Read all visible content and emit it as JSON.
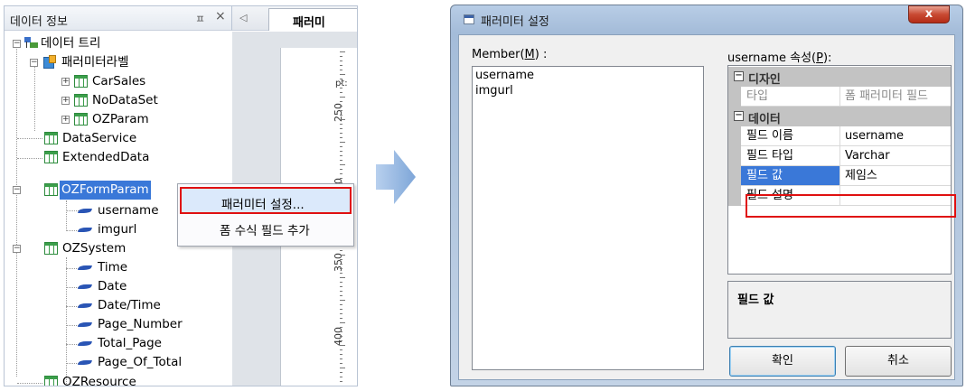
{
  "left_panel": {
    "title": "데이터 정보",
    "pin_glyph": "ㅍ",
    "close_glyph": "×",
    "tab_label": "패러미",
    "ruler_unit": "pt:",
    "ruler_numbers": [
      "250",
      "300",
      "350",
      "400"
    ]
  },
  "tree": {
    "root": "데이터 트리",
    "param_label": "패러미터라벨",
    "items": {
      "carsales": "CarSales",
      "nodataset": "NoDataSet",
      "ozparam": "OZParam",
      "dataservice": "DataService",
      "extendeddata": "ExtendedData",
      "ozformparam": "OZFormParam",
      "username": "username",
      "imgurl": "imgurl",
      "ozsystem": "OZSystem",
      "time": "Time",
      "date": "Date",
      "datetime": "Date/Time",
      "page_number": "Page_Number",
      "total_page": "Total_Page",
      "page_of_total": "Page_Of_Total",
      "ozresource": "OZResource"
    }
  },
  "context_menu": {
    "item1": "패러미터 설정...",
    "item2": "폼 수식 필드 추가"
  },
  "dialog": {
    "title": "패러미터 설정",
    "close_label": "x",
    "member_label_pre": "Member(",
    "member_label_key": "M",
    "member_label_post": ") :",
    "members": [
      "username",
      "imgurl"
    ],
    "prop_label_pre": "username 속성(",
    "prop_label_key": "P",
    "prop_label_post": "):",
    "categories": {
      "design": "디자인",
      "data": "데이터"
    },
    "properties": {
      "type_name": "타입",
      "type_value": "폼 패러미터 필드",
      "field_name_name": "필드 이름",
      "field_name_value": "username",
      "field_type_name": "필드 타입",
      "field_type_value": "Varchar",
      "field_value_name": "필드 값",
      "field_value_value": "제임스",
      "field_desc_name": "필드 설명",
      "field_desc_value": ""
    },
    "description_title": "필드 값",
    "ok_label": "확인",
    "cancel_label": "취소"
  },
  "colors": {
    "selection": "#3a78d8",
    "highlight": "#e01010",
    "arrow": "#8fb4df"
  }
}
